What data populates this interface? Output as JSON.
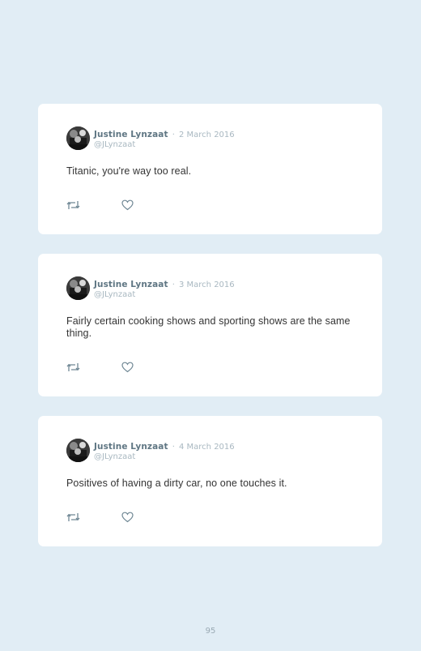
{
  "tweets": [
    {
      "author_name": "Justine Lynzaat",
      "separator": "·",
      "date": "2 March 2016",
      "handle": "@JLynzaat",
      "text": "Titanic, you're way too real.",
      "icons": [
        "retweet-icon",
        "heart-icon"
      ]
    },
    {
      "author_name": "Justine Lynzaat",
      "separator": "·",
      "date": "3 March 2016",
      "handle": "@JLynzaat",
      "text": "Fairly certain cooking shows and sporting shows are the same thing.",
      "icons": [
        "retweet-icon",
        "heart-icon"
      ]
    },
    {
      "author_name": "Justine Lynzaat",
      "separator": "·",
      "date": "4 March 2016",
      "handle": "@JLynzaat",
      "text": "Positives of having a dirty car, no one touches it.",
      "icons": [
        "retweet-icon",
        "heart-icon"
      ]
    }
  ],
  "page_number": "95",
  "colors": {
    "background": "#e1edf5",
    "card": "#ffffff",
    "author_name": "#5f7683",
    "muted": "#a9b8c1",
    "text": "#333333"
  }
}
